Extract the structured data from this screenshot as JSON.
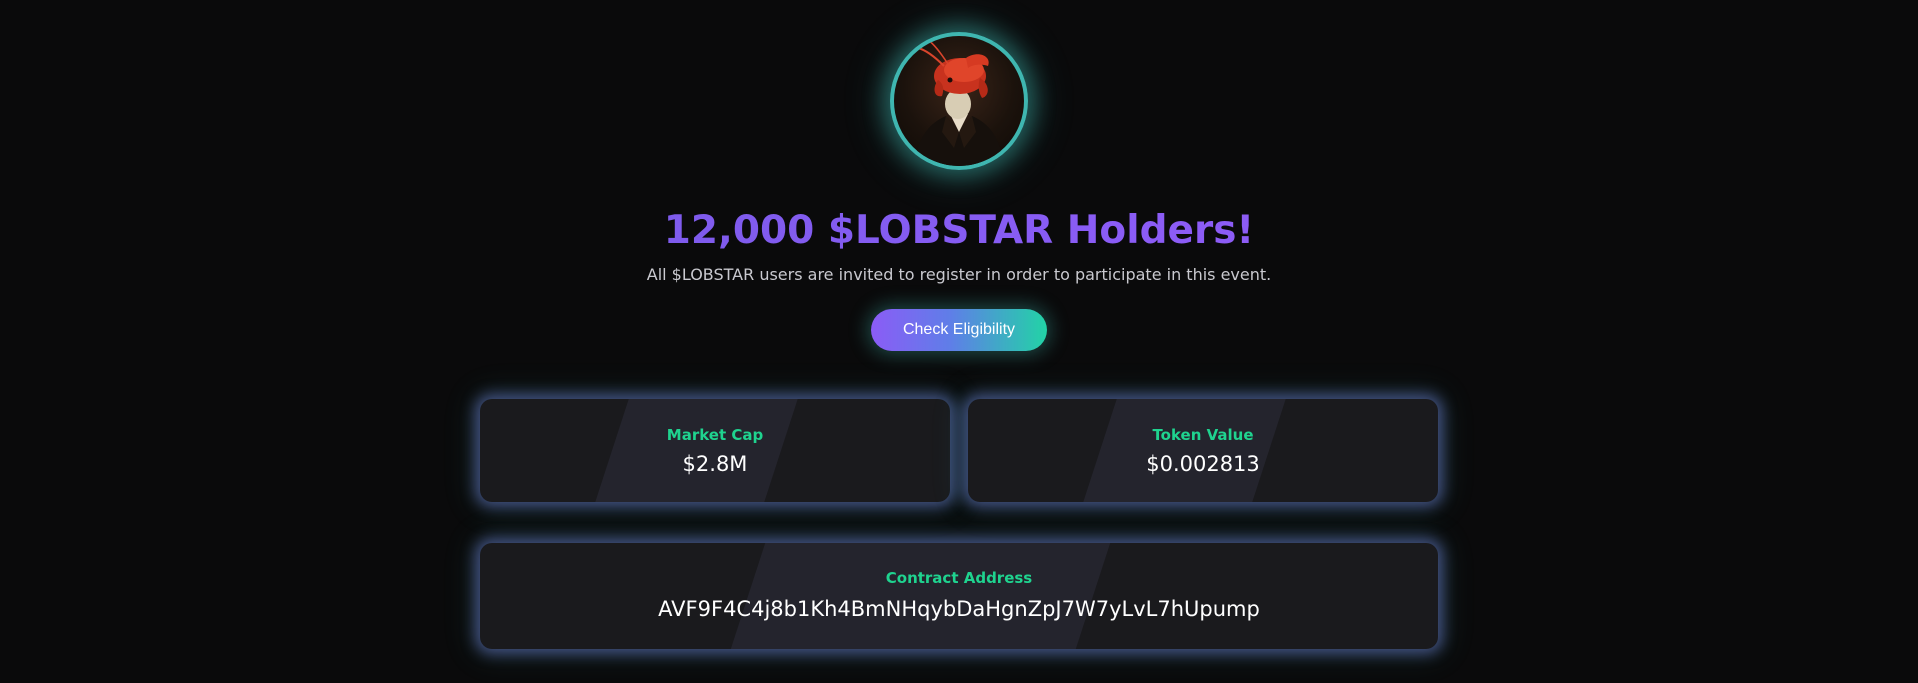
{
  "hero": {
    "avatar_icon": "lobster-portrait-icon",
    "title": "12,000 $LOBSTAR Holders!",
    "subtitle": "All $LOBSTAR users are invited to register in order to participate in this event.",
    "cta_label": "Check Eligibility"
  },
  "stats": {
    "market_cap_label": "Market Cap",
    "market_cap_value": "$2.8M",
    "token_value_label": "Token Value",
    "token_value_value": "$0.002813"
  },
  "contract": {
    "label": "Contract Address",
    "value": "AVF9F4C4j8b1Kh4BmNHqybDaHgnZpJ7W7yLvL7hUpump"
  },
  "colors": {
    "background": "#0a0a0b",
    "accent_purple": "#8b5cf6",
    "accent_green": "#1fd38f",
    "accent_teal": "#3fb6b0",
    "card_bg": "#1a1a1d"
  }
}
